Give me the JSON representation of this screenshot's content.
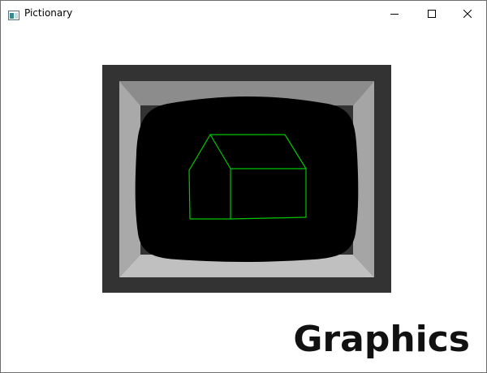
{
  "window": {
    "title": "Pictionary",
    "minimize_icon": "minimize-icon",
    "maximize_icon": "maximize-icon",
    "close_icon": "close-icon"
  },
  "picture": {
    "subject": "house-wireframe",
    "colors": {
      "bezel_outer": "#333333",
      "bezel_top": "#8c8c8c",
      "bezel_left": "#a9a9a9",
      "bezel_right": "#a5a5a5",
      "bezel_bottom": "#c0c0c0",
      "screen": "#000000",
      "wireframe": "#00c800"
    }
  },
  "caption": "Graphics"
}
